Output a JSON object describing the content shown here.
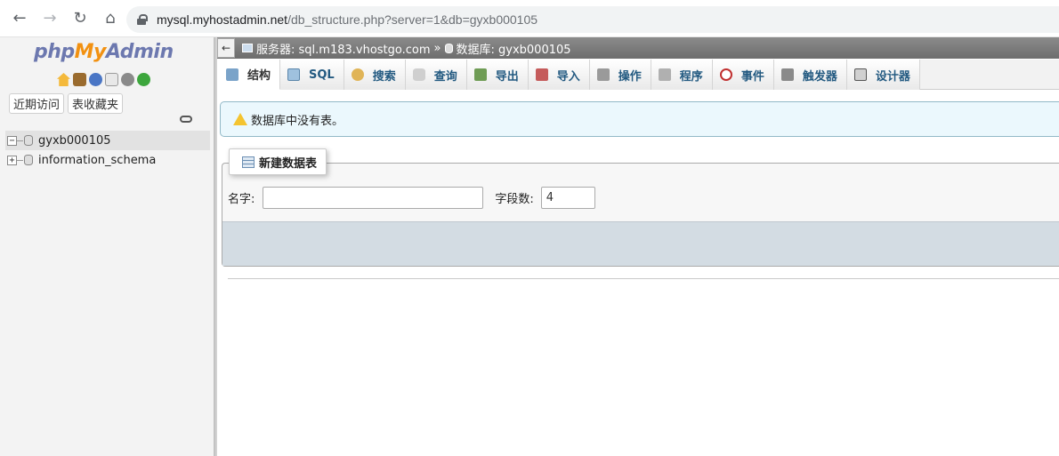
{
  "browser": {
    "url_host": "mysql.myhostadmin.net",
    "url_path": "/db_structure.php?server=1&db=gyxb000105"
  },
  "logo": {
    "part1": "php",
    "part2": "My",
    "part3": "Admin"
  },
  "nav_tabs": [
    {
      "label": "近期访问"
    },
    {
      "label": "表收藏夹"
    }
  ],
  "tree": [
    {
      "expander": "−",
      "label": "gyxb000105"
    },
    {
      "expander": "+",
      "label": "information_schema"
    }
  ],
  "breadcrumb": {
    "collapse": "←",
    "server_label": "服务器: sql.m183.vhostgo.com",
    "separator": "»",
    "database_label": "数据库: gyxb000105"
  },
  "tabs": [
    {
      "label": "结构",
      "icon": "structure-icon"
    },
    {
      "label": "SQL",
      "icon": "sql-icon"
    },
    {
      "label": "搜索",
      "icon": "search-icon"
    },
    {
      "label": "查询",
      "icon": "query-icon"
    },
    {
      "label": "导出",
      "icon": "export-icon"
    },
    {
      "label": "导入",
      "icon": "import-icon"
    },
    {
      "label": "操作",
      "icon": "operations-icon"
    },
    {
      "label": "程序",
      "icon": "routines-icon"
    },
    {
      "label": "事件",
      "icon": "events-icon"
    },
    {
      "label": "触发器",
      "icon": "triggers-icon"
    },
    {
      "label": "设计器",
      "icon": "designer-icon"
    }
  ],
  "notice": {
    "text": "数据库中没有表。"
  },
  "create_table": {
    "legend": "新建数据表",
    "name_label": "名字:",
    "name_value": "",
    "fields_label": "字段数:",
    "fields_value": "4"
  }
}
